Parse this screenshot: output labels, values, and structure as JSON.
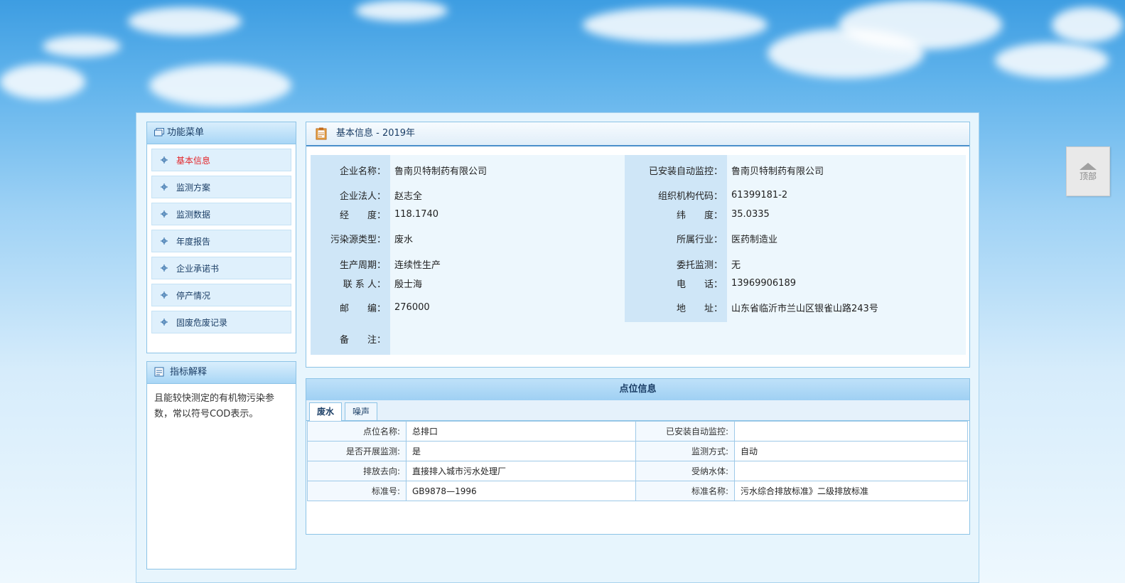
{
  "sidebar": {
    "menu_title": "功能菜单",
    "items": [
      {
        "label": "基本信息",
        "active": true
      },
      {
        "label": "监测方案",
        "active": false
      },
      {
        "label": "监测数据",
        "active": false
      },
      {
        "label": "年度报告",
        "active": false
      },
      {
        "label": "企业承诺书",
        "active": false
      },
      {
        "label": "停产情况",
        "active": false
      },
      {
        "label": "固废危废记录",
        "active": false
      }
    ],
    "indicator_title": "指标解释",
    "indicator_text": "且能较快测定的有机物污染参数，常以符号COD表示。"
  },
  "basic_info": {
    "title": "基本信息 - 2019年",
    "rows": [
      {
        "l1": "企业名称：",
        "v1": "鲁南贝特制药有限公司",
        "l2": "已安装自动监控：",
        "v2": "鲁南贝特制药有限公司"
      },
      {
        "l1": "企业法人：",
        "v1": "赵志全",
        "l2": "组织机构代码：",
        "v2": "61399181-2"
      },
      {
        "l1": "经　　度：",
        "v1": "118.1740",
        "l2": "纬　　度：",
        "v2": "35.0335"
      },
      {
        "l1": "污染源类型：",
        "v1": "废水",
        "l2": "所属行业：",
        "v2": "医药制造业"
      },
      {
        "l1": "生产周期：",
        "v1": "连续性生产",
        "l2": "委托监测：",
        "v2": "无"
      },
      {
        "l1": "联 系 人：",
        "v1": "殷士海",
        "l2": "电　　话：",
        "v2": "13969906189"
      },
      {
        "l1": "邮　　编：",
        "v1": "276000",
        "l2": "地　　址：",
        "v2": "山东省临沂市兰山区银雀山路243号"
      }
    ],
    "remark_label": "备　　注：",
    "remark_value": ""
  },
  "points": {
    "title": "点位信息",
    "tabs": [
      "废水",
      "噪声"
    ],
    "rows": [
      {
        "l1": "点位名称:",
        "v1": "总排口",
        "l2": "已安装自动监控:",
        "v2": ""
      },
      {
        "l1": "是否开展监测:",
        "v1": "是",
        "l2": "监测方式:",
        "v2": "自动"
      },
      {
        "l1": "排放去向:",
        "v1": "直接排入城市污水处理厂",
        "l2": "受纳水体:",
        "v2": ""
      },
      {
        "l1": "标准号:",
        "v1": "GB9878—1996",
        "l2": "标准名称:",
        "v2": "污水综合排放标准》二级排放标准"
      }
    ]
  },
  "to_top": {
    "label": "顶部"
  }
}
